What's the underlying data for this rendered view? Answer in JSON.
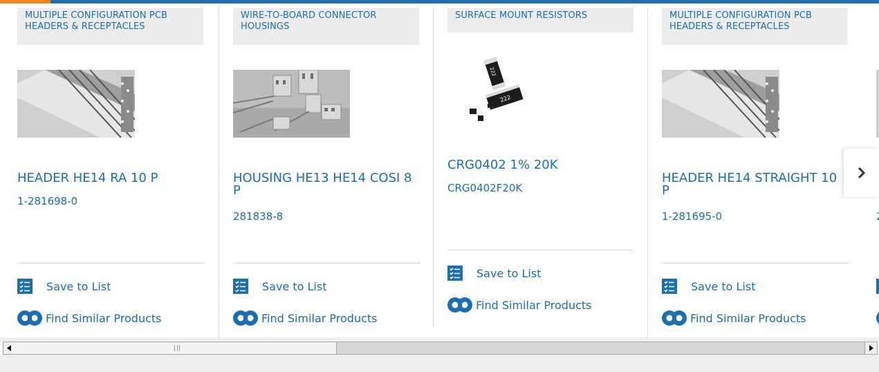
{
  "colors": {
    "accent": "#1a6fb0",
    "topbar": "#1f6fae",
    "topbar_accent": "#f0851e"
  },
  "cards": [
    {
      "category": "MULTIPLE CONFIGURATION PCB HEADERS & RECEPTACLES",
      "title": "HEADER HE14 RA 10 P",
      "part_number": "1-281698-0",
      "image": "pcb-header-photo",
      "save_label": "Save to List",
      "similar_label": "Find Similar Products"
    },
    {
      "category": "WIRE-TO-BOARD CONNECTOR HOUSINGS",
      "title": "HOUSING HE13 HE14 COSI 8 P",
      "part_number": "281838-8",
      "image": "connector-housings-photo",
      "save_label": "Save to List",
      "similar_label": "Find Similar Products"
    },
    {
      "category": "SURFACE MOUNT RESISTORS",
      "title": "CRG0402 1% 20K",
      "part_number": "CRG0402F20K",
      "image": "smd-resistors-photo",
      "resistor_marking": "222",
      "save_label": "Save to List",
      "similar_label": "Find Similar Products"
    },
    {
      "category": "MULTIPLE CONFIGURATION PCB HEADERS & RECEPTACLES",
      "title": "HEADER HE14 STRAIGHT 10 P",
      "part_number": "1-281695-0",
      "image": "pcb-header-photo",
      "save_label": "Save to List",
      "similar_label": "Find Similar Products"
    }
  ],
  "partial_card": {
    "title_fragment": "V",
    "pn_fragment": "2"
  },
  "icons": {
    "save": "checklist-icon",
    "similar": "binoculars-icon",
    "next": "chevron-right-icon",
    "scroll_left": "arrow-left-icon",
    "scroll_right": "arrow-right-icon"
  }
}
